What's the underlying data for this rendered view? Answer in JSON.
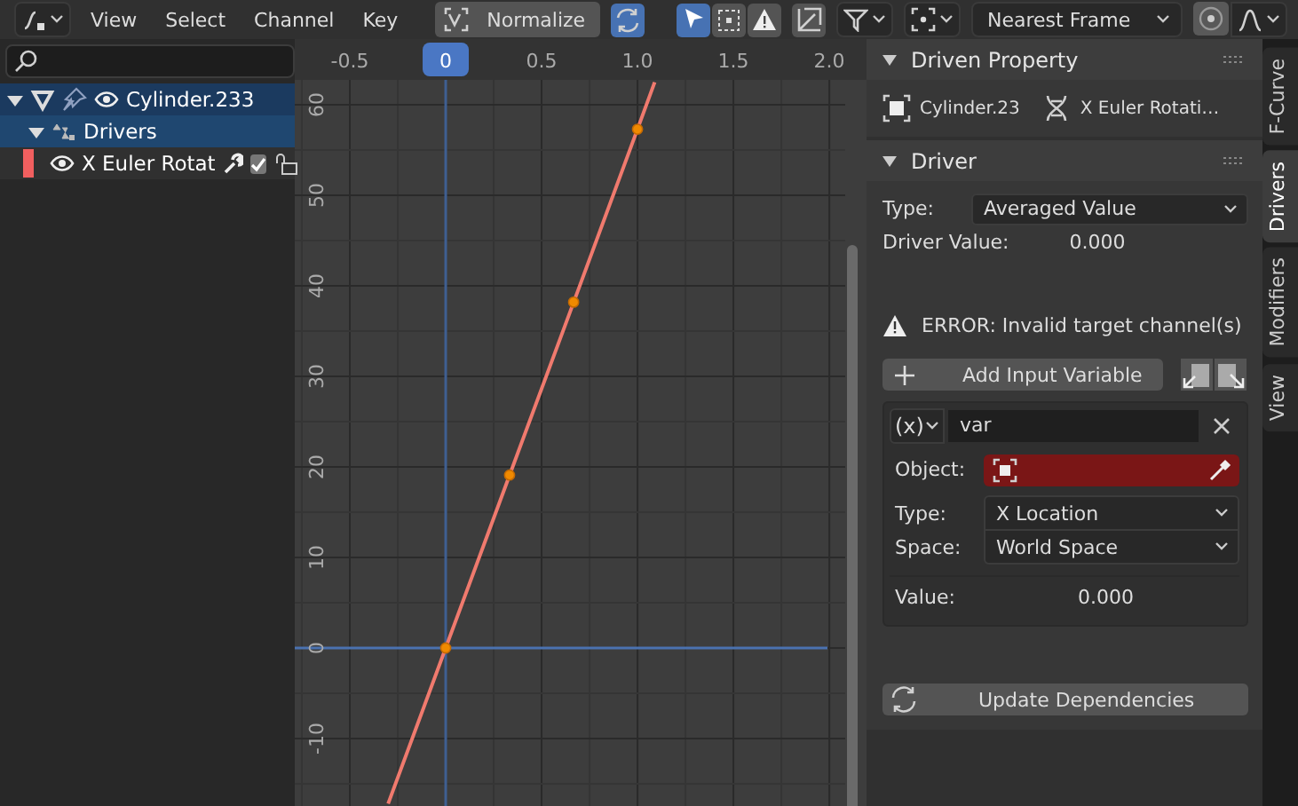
{
  "header": {
    "menus": [
      "View",
      "Select",
      "Channel",
      "Key"
    ],
    "normalize": {
      "label": "Normalize",
      "on": false
    },
    "auto_normalize": {
      "on": true
    },
    "view_toggles": [
      {
        "kind": "arrow",
        "on": true
      },
      {
        "kind": "box",
        "on": false
      },
      {
        "kind": "warning",
        "on": false
      }
    ],
    "snap": "Nearest Frame",
    "proportional": {
      "on": false
    }
  },
  "channels": [
    {
      "kind": "object",
      "label": "Cylinder.233",
      "selected": true,
      "expanded": true,
      "children": [
        {
          "kind": "group",
          "label": "Drivers",
          "selected": true,
          "expanded": true,
          "children": [
            {
              "kind": "fcurve",
              "label": "X Euler Rotat",
              "selected": false,
              "color": "#f15f5f",
              "checked": true,
              "locked": false
            }
          ]
        }
      ]
    }
  ],
  "graph": {
    "cursor": {
      "label": "0"
    },
    "chart_data": {
      "type": "line",
      "x": [
        -0.3,
        0,
        0.333,
        0.667,
        1.0,
        1.09
      ],
      "series": [
        {
          "color": "#f07a6e",
          "values": [
            -17.2,
            0,
            19.1,
            38.2,
            57.3,
            62.5
          ]
        }
      ],
      "xlim": [
        -0.787,
        2.083
      ],
      "ylim": [
        -17.45,
        62.75
      ],
      "grid": true,
      "ref_lines": [
        {
          "axis": "y",
          "value": 0,
          "color": "#4a72b0"
        },
        {
          "axis": "x",
          "value": 0,
          "color": "#3f5f92"
        }
      ],
      "xticks": [
        -0.5,
        {
          "value": 0.5,
          "label": "0.5"
        },
        {
          "value": 1,
          "label": "1.0"
        },
        {
          "value": 1.5,
          "label": "1.5"
        },
        {
          "value": 2,
          "label": "2.0"
        }
      ],
      "yticks": [
        -10,
        0,
        10,
        20,
        30,
        40,
        50,
        60
      ]
    }
  },
  "sidebar": {
    "tabs": [
      {
        "label": "F-Curve",
        "selected": false
      },
      {
        "label": "Drivers",
        "selected": true
      },
      {
        "label": "Modifiers",
        "selected": false
      },
      {
        "label": "View",
        "selected": false
      }
    ],
    "driven_property": {
      "title": "Driven Property",
      "expanded": true,
      "object": "Cylinder.23",
      "property": "X Euler Rotati…"
    },
    "driver": {
      "title": "Driver",
      "expanded": true,
      "type_label": "Type:",
      "type_value": "Averaged Value",
      "value_label": "Driver Value:",
      "value": "0.000",
      "error": "ERROR: Invalid target channel(s)",
      "add_button": "Add Input Variable",
      "variable": {
        "type_icon": "(x)",
        "name": "var",
        "object_label": "Object:",
        "object_invalid": true,
        "type_label": "Type:",
        "type_value": "X Location",
        "space_label": "Space:",
        "space_value": "World Space",
        "value_label": "Value:",
        "value": "0.000"
      },
      "update_button": "Update Dependencies"
    }
  }
}
